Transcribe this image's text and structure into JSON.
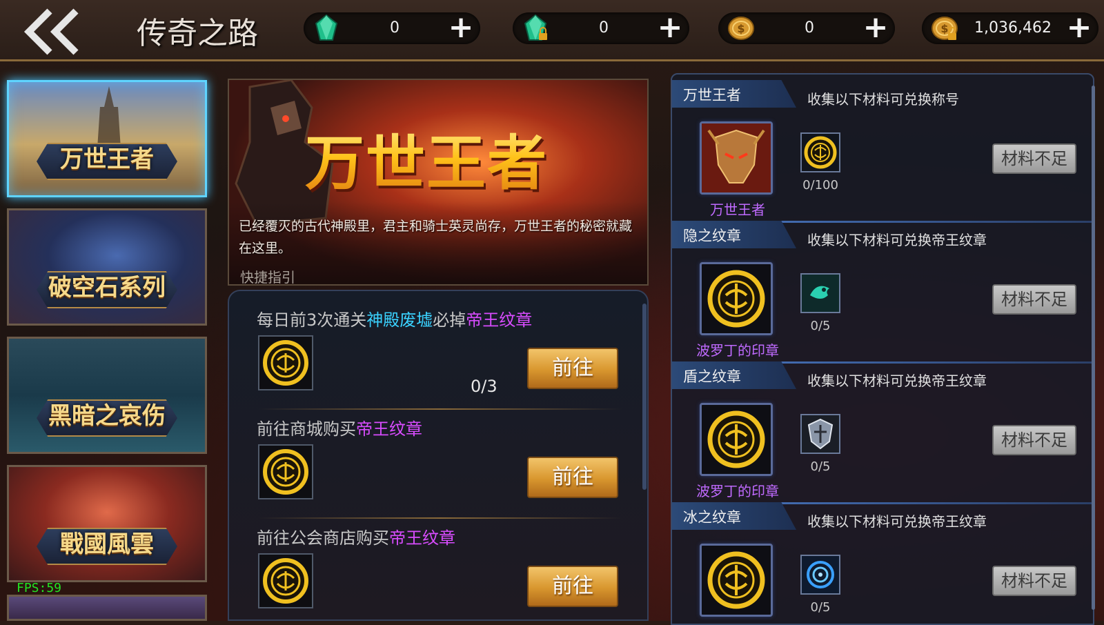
{
  "header": {
    "back_icon": "double-chevron-left-icon",
    "title": "传奇之路",
    "currencies": [
      {
        "name": "diamond",
        "icon": "green-gem-icon",
        "value": "0",
        "plus": "+"
      },
      {
        "name": "bound-diamond",
        "icon": "locked-green-gem-icon",
        "value": "0",
        "plus": "+"
      },
      {
        "name": "coin",
        "icon": "gold-coin-icon",
        "value": "0",
        "plus": "+"
      },
      {
        "name": "bound-coin",
        "icon": "locked-gold-coin-icon",
        "value": "1,036,462",
        "plus": "+"
      }
    ]
  },
  "sidebar": {
    "items": [
      {
        "label": "万世王者",
        "active": true
      },
      {
        "label": "破空石系列",
        "active": false
      },
      {
        "label": "黑暗之哀伤",
        "active": false
      },
      {
        "label": "戰國風雲",
        "active": false
      }
    ],
    "fps": "FPS:59"
  },
  "hero": {
    "title": "万世王者",
    "description": "已经覆灭的古代神殿里，君主和骑士英灵尚存，万世王者的秘密就藏在这里。"
  },
  "guide": {
    "label": "快捷指引",
    "tasks": [
      {
        "prefix": "每日前3次通关",
        "highlight1": "神殿废墟",
        "middle": "必掉",
        "highlight2": "帝王纹章",
        "count": "0/3",
        "button": "前往",
        "icon": "emperor-emblem-icon"
      },
      {
        "prefix": "前往商城购买",
        "highlight1": "",
        "middle": "",
        "highlight2": "帝王纹章",
        "count": "",
        "button": "前往",
        "icon": "emperor-emblem-icon"
      },
      {
        "prefix": "前往公会商店购买",
        "highlight1": "",
        "middle": "",
        "highlight2": "帝王纹章",
        "count": "",
        "button": "前往",
        "icon": "emperor-emblem-icon"
      }
    ]
  },
  "exchange": {
    "rows": [
      {
        "tab": "万世王者",
        "desc": "收集以下材料可兑换称号",
        "reward_name": "万世王者",
        "reward_icon": "demon-helmet-icon",
        "material_icon": "emperor-emblem-icon",
        "count": "0/100",
        "button": "材料不足"
      },
      {
        "tab": "隐之纹章",
        "desc": "收集以下材料可兑换帝王纹章",
        "reward_name": "波罗丁的印章",
        "reward_icon": "emperor-emblem-icon",
        "material_icon": "hidden-crest-icon",
        "count": "0/5",
        "button": "材料不足"
      },
      {
        "tab": "盾之纹章",
        "desc": "收集以下材料可兑换帝王纹章",
        "reward_name": "波罗丁的印章",
        "reward_icon": "emperor-emblem-icon",
        "material_icon": "shield-crest-icon",
        "count": "0/5",
        "button": "材料不足"
      },
      {
        "tab": "冰之纹章",
        "desc": "收集以下材料可兑换帝王纹章",
        "reward_name": "",
        "reward_icon": "emperor-emblem-icon",
        "material_icon": "ice-crest-icon",
        "count": "0/5",
        "button": "材料不足"
      }
    ]
  },
  "colors": {
    "accent_gold": "#d8962e",
    "highlight_cyan": "#3ad2ff",
    "highlight_purple": "#d94cff",
    "active_border": "#5fd4ff",
    "fps_green": "#22e622"
  }
}
